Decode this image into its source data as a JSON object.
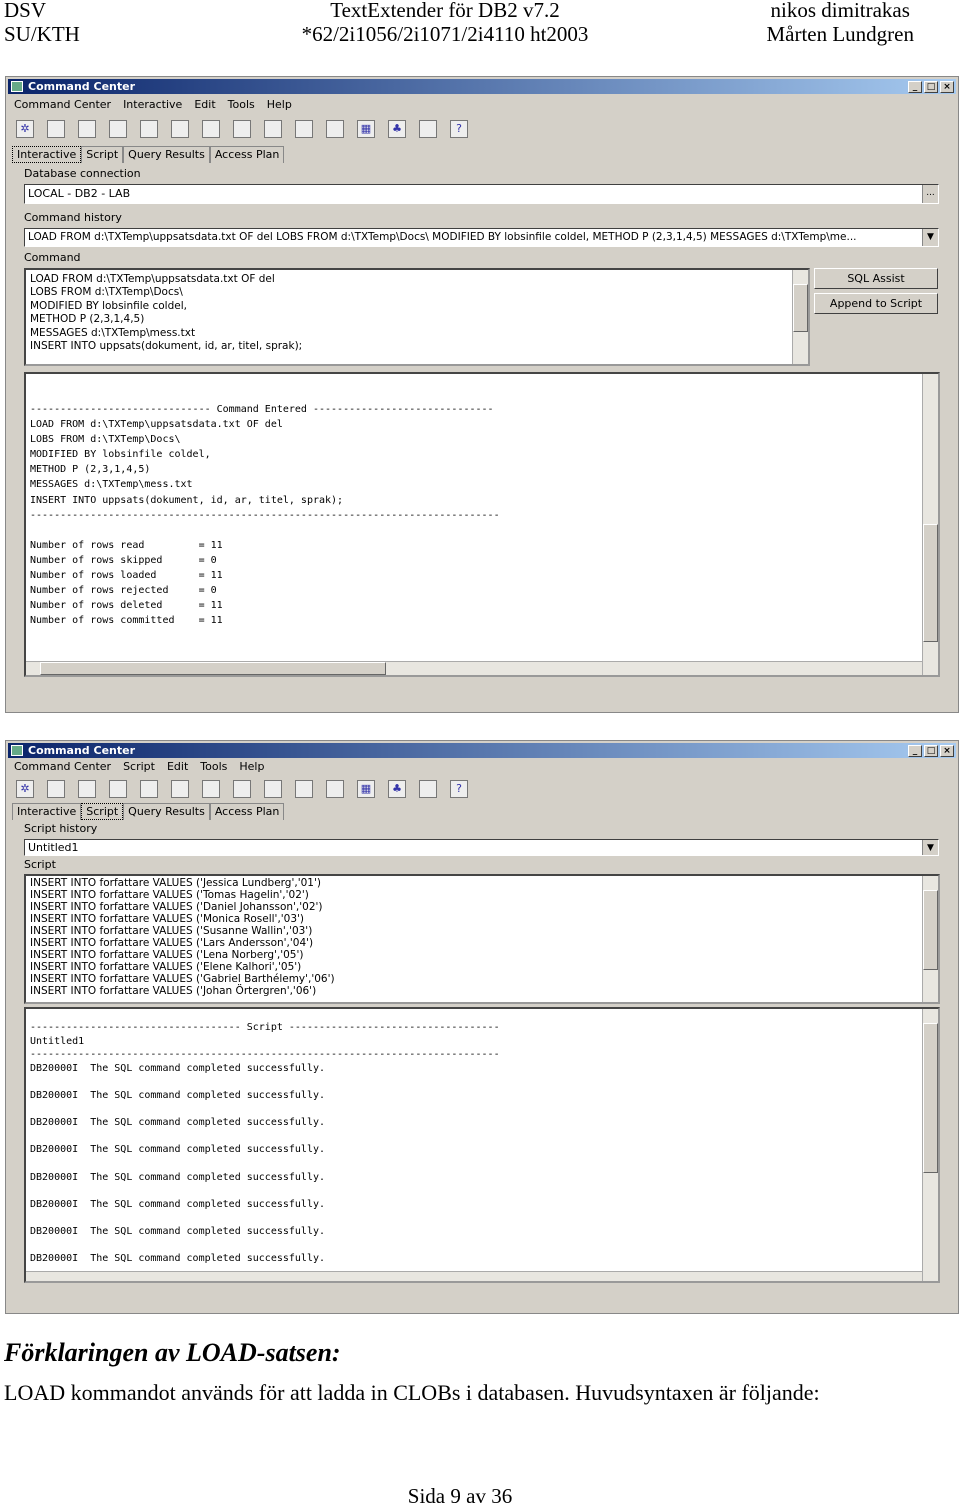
{
  "header": {
    "left1": "DSV",
    "left2": "SU/KTH",
    "center1": "TextExtender för DB2 v7.2",
    "center2": "*62/2i1056/2i1071/2i4110 ht2003",
    "right1": "nikos dimitrakas",
    "right2": "Mårten Lundgren"
  },
  "window1": {
    "title": "Command Center",
    "menu": [
      "Command Center",
      "Interactive",
      "Edit",
      "Tools",
      "Help"
    ],
    "tabs": [
      "Interactive",
      "Script",
      "Query Results",
      "Access Plan"
    ],
    "active_tab": "Interactive",
    "db_label": "Database connection",
    "db_value": "LOCAL - DB2 - LAB",
    "db_button": "...",
    "history_label": "Command history",
    "history_value": "LOAD FROM d:\\TXTemp\\uppsatsdata.txt OF del LOBS FROM d:\\TXTemp\\Docs\\ MODIFIED BY lobsinfile coldel, METHOD P (2,3,1,4,5) MESSAGES d:\\TXTemp\\me...",
    "command_label": "Command",
    "command_lines": [
      "LOAD FROM d:\\TXTemp\\uppsatsdata.txt OF del",
      "LOBS FROM d:\\TXTemp\\Docs\\",
      "MODIFIED BY lobsinfile coldel,",
      "METHOD P (2,3,1,4,5)",
      "MESSAGES d:\\TXTemp\\mess.txt",
      "INSERT INTO uppsats(dokument, id, ar, titel, sprak);"
    ],
    "sql_assist": "SQL Assist",
    "append_script": "Append to Script",
    "output_lines": [
      "------------------------------ Command Entered ------------------------------",
      "LOAD FROM d:\\TXTemp\\uppsatsdata.txt OF del",
      "LOBS FROM d:\\TXTemp\\Docs\\",
      "MODIFIED BY lobsinfile coldel,",
      "METHOD P (2,3,1,4,5)",
      "MESSAGES d:\\TXTemp\\mess.txt",
      "INSERT INTO uppsats(dokument, id, ar, titel, sprak);",
      "------------------------------------------------------------------------------",
      "",
      "Number of rows read         = 11",
      "Number of rows skipped      = 0",
      "Number of rows loaded       = 11",
      "Number of rows rejected     = 0",
      "Number of rows deleted      = 11",
      "Number of rows committed    = 11"
    ]
  },
  "window2": {
    "title": "Command Center",
    "menu": [
      "Command Center",
      "Script",
      "Edit",
      "Tools",
      "Help"
    ],
    "tabs": [
      "Interactive",
      "Script",
      "Query Results",
      "Access Plan"
    ],
    "active_tab": "Script",
    "history_label": "Script history",
    "history_value": "Untitled1",
    "script_label": "Script",
    "script_lines": [
      "INSERT INTO forfattare VALUES ('Jessica Lundberg','01')",
      "INSERT INTO forfattare VALUES ('Tomas Hagelin','02')",
      "INSERT INTO forfattare VALUES ('Daniel Johansson','02')",
      "INSERT INTO forfattare VALUES ('Monica Rosell','03')",
      "INSERT INTO forfattare VALUES ('Susanne Wallin','03')",
      "INSERT INTO forfattare VALUES ('Lars Andersson','04')",
      "INSERT INTO forfattare VALUES ('Lena Norberg','05')",
      "INSERT INTO forfattare VALUES ('Elene Kalhori','05')",
      "INSERT INTO forfattare VALUES ('Gabriel Barthélemy','06')",
      "INSERT INTO forfattare VALUES ('Johan Örtergren','06')"
    ],
    "output_lines": [
      "----------------------------------- Script -----------------------------------",
      "Untitled1",
      "------------------------------------------------------------------------------",
      "DB20000I  The SQL command completed successfully.",
      "",
      "DB20000I  The SQL command completed successfully.",
      "",
      "DB20000I  The SQL command completed successfully.",
      "",
      "DB20000I  The SQL command completed successfully.",
      "",
      "DB20000I  The SQL command completed successfully.",
      "",
      "DB20000I  The SQL command completed successfully.",
      "",
      "DB20000I  The SQL command completed successfully.",
      "",
      "DB20000I  The SQL command completed successfully."
    ]
  },
  "heading": "Förklaringen av LOAD-satsen:",
  "paragraph": "LOAD kommandot används för att ladda in CLOBs i databasen. Huvudsyntaxen är följande:",
  "footer": "Sida 9 av 36"
}
